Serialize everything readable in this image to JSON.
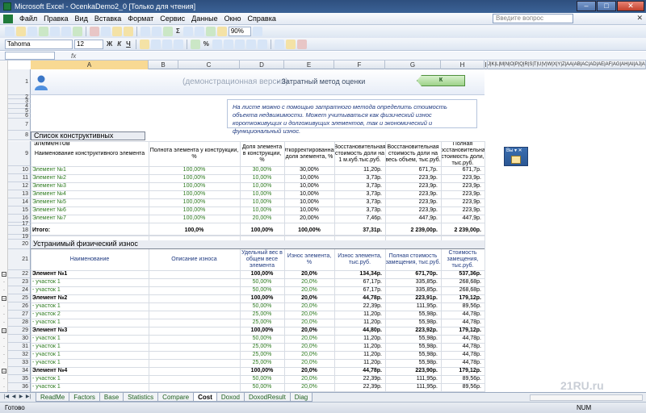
{
  "window": {
    "title": "Microsoft Excel - OcenkaDemo2_0  [Только для чтения]"
  },
  "menu": {
    "items": [
      "Файл",
      "Правка",
      "Вид",
      "Вставка",
      "Формат",
      "Сервис",
      "Данные",
      "Окно",
      "Справка"
    ],
    "help_placeholder": "Введите вопрос"
  },
  "toolbar": {
    "font": "Tahoma",
    "size": "12",
    "zoom": "90%"
  },
  "formula": {
    "fx": "fx"
  },
  "columns": [
    {
      "label": "A",
      "sel": true
    },
    {
      "label": "B"
    },
    {
      "label": "C"
    },
    {
      "label": "D"
    },
    {
      "label": "E"
    },
    {
      "label": "F"
    },
    {
      "label": "G"
    },
    {
      "label": "H"
    },
    {
      "label": "I"
    },
    {
      "label": "J|K|L|M|N|O|P|Q|R|S|T|U|V|W|X|Y|Z|AA|AB|AC|AD|AE|AF|AG|AH|AI|AJ|AK|AL|AM|AN"
    }
  ],
  "banner": {
    "demo": "(демонстрационная версия)",
    "method": "- Затратный метод оценки",
    "info_button": "К ИНФОРМАЦИИ"
  },
  "note": "На листе можно с помощью затратного метода определить стоимость объекта недвижимости. Может учитываться как физический износ короткоживущих и долгоживущих элементов, так и экономический и функциональный износ.",
  "section1": {
    "title": "Список конструктивных элементов",
    "headers": [
      "Наименование конструктивного элемента",
      "Полнота элемента у конструкции, %",
      "Доля элемента в конструкции, %",
      "Откорректированная доля элемента, %",
      "Восстановительная стоимость доли на 1 м.куб.тыс.руб.",
      "Восстановительная стоимость доли на весь объем, тыс.руб.",
      "Полная восстановительная стоимость доли, тыс.руб."
    ],
    "rows": [
      {
        "r": "10",
        "name": "Элемент №1",
        "full": "100,00%",
        "share": "30,00%",
        "adj": "30,00%",
        "per": "11,20р.",
        "vol": "671,7р.",
        "total": "671,7р."
      },
      {
        "r": "11",
        "name": "Элемент №2",
        "full": "100,00%",
        "share": "10,00%",
        "adj": "10,00%",
        "per": "3,73р.",
        "vol": "223,9р.",
        "total": "223,9р."
      },
      {
        "r": "12",
        "name": "Элемент №3",
        "full": "100,00%",
        "share": "10,00%",
        "adj": "10,00%",
        "per": "3,73р.",
        "vol": "223,9р.",
        "total": "223,9р."
      },
      {
        "r": "13",
        "name": "Элемент №4",
        "full": "100,00%",
        "share": "10,00%",
        "adj": "10,00%",
        "per": "3,73р.",
        "vol": "223,9р.",
        "total": "223,9р."
      },
      {
        "r": "14",
        "name": "Элемент №5",
        "full": "100,00%",
        "share": "10,00%",
        "adj": "10,00%",
        "per": "3,73р.",
        "vol": "223,9р.",
        "total": "223,9р."
      },
      {
        "r": "15",
        "name": "Элемент №6",
        "full": "100,00%",
        "share": "10,00%",
        "adj": "10,00%",
        "per": "3,73р.",
        "vol": "223,9р.",
        "total": "223,9р."
      },
      {
        "r": "16",
        "name": "Элемент №7",
        "full": "100,00%",
        "share": "20,00%",
        "adj": "20,00%",
        "per": "7,46р.",
        "vol": "447,9р.",
        "total": "447,9р."
      }
    ],
    "total": {
      "r": "18",
      "name": "Итого:",
      "full": "100,0%",
      "share": "100,00%",
      "adj": "100,00%",
      "per": "37,31р.",
      "vol": "2 239,00р.",
      "total": "2 239,00р."
    }
  },
  "section2": {
    "title": "Устранимый физический износ",
    "headers": [
      "Наименование",
      "Описание износа",
      "Удельный вес в общем весе элемента",
      "Износ элемента, %",
      "Износ элемента, тыс.руб.",
      "Полная стоимость замещения, тыс.руб.",
      "Стоимость замещения, тыс.руб."
    ],
    "rows": [
      {
        "r": "22",
        "name": "Элемент №1",
        "bold": true,
        "w": "100,00%",
        "wear": "20,0%",
        "amt": "134,34р.",
        "full": "671,70р.",
        "repl": "537,36р."
      },
      {
        "r": "23",
        "name": "- участок 1",
        "w": "50,00%",
        "wear": "20,0%",
        "amt": "67,17р.",
        "full": "335,85р.",
        "repl": "268,68р."
      },
      {
        "r": "24",
        "name": "- участок 1",
        "w": "50,00%",
        "wear": "20,0%",
        "amt": "67,17р.",
        "full": "335,85р.",
        "repl": "268,68р."
      },
      {
        "r": "25",
        "name": "Элемент №2",
        "bold": true,
        "w": "100,00%",
        "wear": "20,0%",
        "amt": "44,78р.",
        "full": "223,91р.",
        "repl": "179,12р."
      },
      {
        "r": "26",
        "name": "- участок 1",
        "w": "50,00%",
        "wear": "20,0%",
        "amt": "22,39р.",
        "full": "111,95р.",
        "repl": "89,56р."
      },
      {
        "r": "27",
        "name": "- участок 2",
        "w": "25,00%",
        "wear": "20,0%",
        "amt": "11,20р.",
        "full": "55,98р.",
        "repl": "44,78р."
      },
      {
        "r": "28",
        "name": "- участок 1",
        "w": "25,00%",
        "wear": "20,0%",
        "amt": "11,20р.",
        "full": "55,98р.",
        "repl": "44,78р."
      },
      {
        "r": "29",
        "name": "Элемент №3",
        "bold": true,
        "w": "100,00%",
        "wear": "20,0%",
        "amt": "44,80р.",
        "full": "223,92р.",
        "repl": "179,12р."
      },
      {
        "r": "30",
        "name": "- участок 1",
        "w": "50,00%",
        "wear": "20,0%",
        "amt": "11,20р.",
        "full": "55,98р.",
        "repl": "44,78р."
      },
      {
        "r": "31",
        "name": "- участок 1",
        "w": "25,00%",
        "wear": "20,0%",
        "amt": "11,20р.",
        "full": "55,98р.",
        "repl": "44,78р."
      },
      {
        "r": "32",
        "name": "- участок 1",
        "w": "25,00%",
        "wear": "20,0%",
        "amt": "11,20р.",
        "full": "55,98р.",
        "repl": "44,78р."
      },
      {
        "r": "33",
        "name": "- участок 1",
        "w": "25,00%",
        "wear": "20,0%",
        "amt": "11,20р.",
        "full": "55,98р.",
        "repl": "44,78р."
      },
      {
        "r": "34",
        "name": "Элемент №4",
        "bold": true,
        "w": "100,00%",
        "wear": "20,0%",
        "amt": "44,78р.",
        "full": "223,90р.",
        "repl": "179,12р."
      },
      {
        "r": "35",
        "name": "- участок 1",
        "w": "50,00%",
        "wear": "20,0%",
        "amt": "22,39р.",
        "full": "111,95р.",
        "repl": "89,56р."
      },
      {
        "r": "36",
        "name": "- участок 1",
        "w": "50,00%",
        "wear": "20,0%",
        "amt": "22,39р.",
        "full": "111,95р.",
        "repl": "89,56р."
      },
      {
        "r": "37",
        "name": "Элемент №5",
        "bold": true,
        "w": "100,00%",
        "wear": "20,0%",
        "amt": "44,79р.",
        "full": "223,93р.",
        "repl": "179,12р."
      },
      {
        "r": "38",
        "name": "- участок 1",
        "w": "50,00%",
        "wear": "20,0%",
        "amt": "22,39р.",
        "full": "111,95р.",
        "repl": "89,56р."
      },
      {
        "r": "39",
        "name": "- участок 1",
        "w": "25,00%",
        "wear": "20,0%",
        "amt": "11,20р.",
        "full": "55,98р.",
        "repl": "44,78р."
      },
      {
        "r": "40",
        "name": "- участок 1",
        "w": "25,00%",
        "wear": "20,0%",
        "amt": "11,20р.",
        "full": "55,98р.",
        "repl": "44,78р."
      }
    ]
  },
  "sheets": [
    "ReadMe",
    "Factors",
    "Base",
    "Statistics",
    "Compare",
    "Cost",
    "Doxod",
    "DoxodResult",
    "Diag"
  ],
  "active_sheet": "Cost",
  "status": {
    "ready": "Готово",
    "num": "NUM"
  },
  "watermark": "21RU.ru"
}
